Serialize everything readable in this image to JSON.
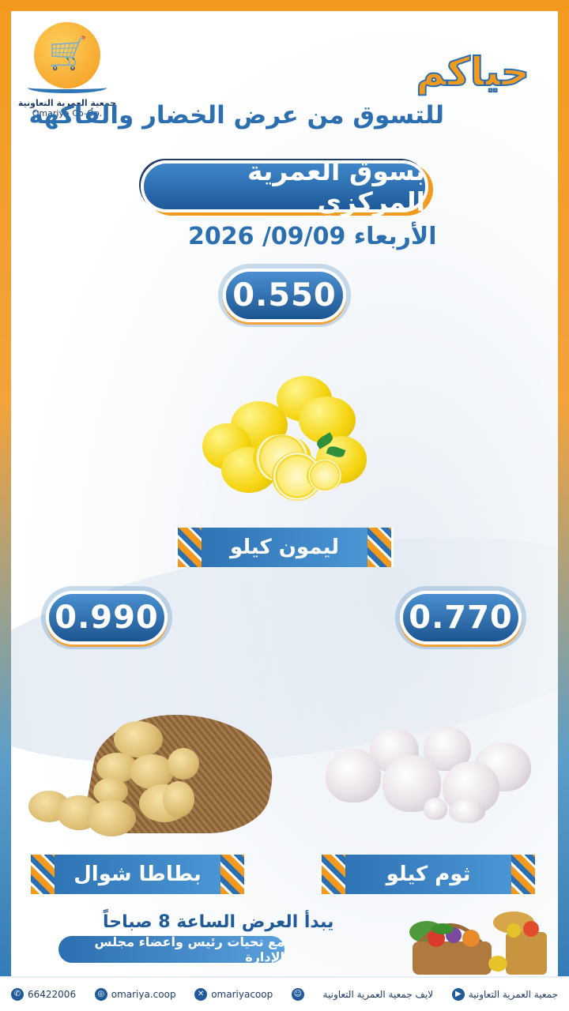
{
  "logo": {
    "name_ar": "جمعية العمرية التعاونية",
    "name_en": "Omariya Co-Op."
  },
  "header": {
    "welcome": "حياكم",
    "subtitle": "للتسوق من عرض الخضار والفاكهة",
    "market": "بسوق العمرية المركزي",
    "date": "الأربعاء 09/09/ 2026"
  },
  "products": [
    {
      "name": "ليمون كيلو",
      "price": "0.550"
    },
    {
      "name": "ثوم كيلو",
      "price": "0.770"
    },
    {
      "name": "بطاطا شوال",
      "price": "0.990"
    }
  ],
  "notice": {
    "start": "يبدأ العرض الساعة 8 صباحاً",
    "greeting": "مع تحيات رئيس وأعضاء مجلس الإدارة"
  },
  "footer": {
    "whatsapp": "66422006",
    "instagram": "omariya.coop",
    "x": "omariyacoop",
    "snapchat_icon": "snapchat-icon",
    "youtube_label": "لايف جمعية العمرية التعاونية",
    "youtube_channel": "جمعية العمرية التعاونية"
  },
  "colors": {
    "orange": "#f39a1e",
    "blue": "#2b6fb0",
    "navy": "#1f3b66"
  }
}
